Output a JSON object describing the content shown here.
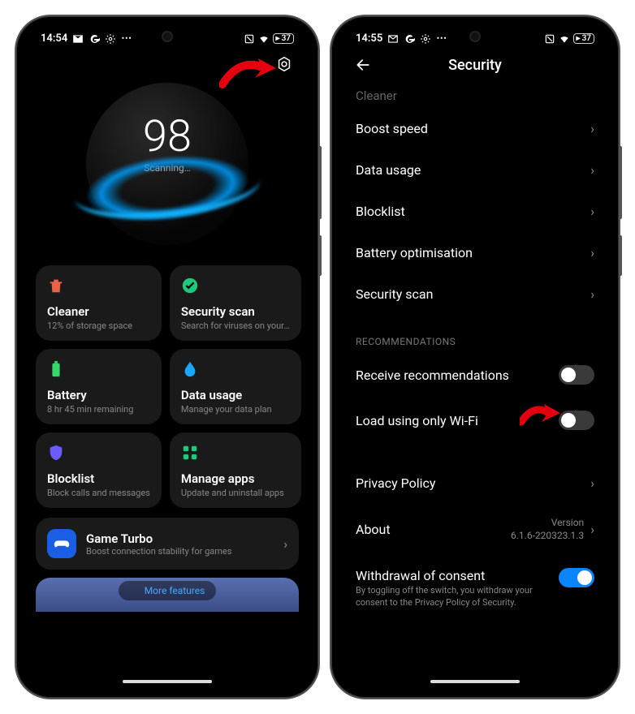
{
  "screen1": {
    "statusbar": {
      "time": "14:54",
      "battery": "37"
    },
    "score": "98",
    "status_label": "Scanning…",
    "tiles": [
      {
        "icon": "trash",
        "color": "#e8624a",
        "title": "Cleaner",
        "sub": "12% of storage space"
      },
      {
        "icon": "check",
        "color": "#1fc97a",
        "title": "Security scan",
        "sub": "Search for viruses on your…"
      },
      {
        "icon": "battery",
        "color": "#36d66b",
        "title": "Battery",
        "sub": "8 hr 45 min  remaining"
      },
      {
        "icon": "drop",
        "color": "#1aa8ff",
        "title": "Data usage",
        "sub": "Manage your data plan"
      },
      {
        "icon": "shield",
        "color": "#6a5cff",
        "title": "Blocklist",
        "sub": "Block calls and messages"
      },
      {
        "icon": "apps",
        "color": "#1fc97a",
        "title": "Manage apps",
        "sub": "Update and uninstall apps"
      }
    ],
    "turbo": {
      "title": "Game Turbo",
      "sub": "Boost connection stability for games"
    },
    "more_label": "More features"
  },
  "screen2": {
    "statusbar": {
      "time": "14:55",
      "battery": "37"
    },
    "title": "Security",
    "cutoff_item": "Cleaner",
    "items": [
      "Boost speed",
      "Data usage",
      "Blocklist",
      "Battery optimisation",
      "Security scan"
    ],
    "section_label": "RECOMMENDATIONS",
    "toggles": [
      {
        "label": "Receive recommendations",
        "on": false
      },
      {
        "label": "Load using only Wi-Fi",
        "on": false
      }
    ],
    "privacy_label": "Privacy Policy",
    "about": {
      "label": "About",
      "version_label": "Version",
      "version": "6.1.6-220323.1.3"
    },
    "consent": {
      "label": "Withdrawal of consent",
      "sub": "By toggling off the switch, you withdraw your consent to the Privacy Policy of Security.",
      "on": true
    }
  }
}
